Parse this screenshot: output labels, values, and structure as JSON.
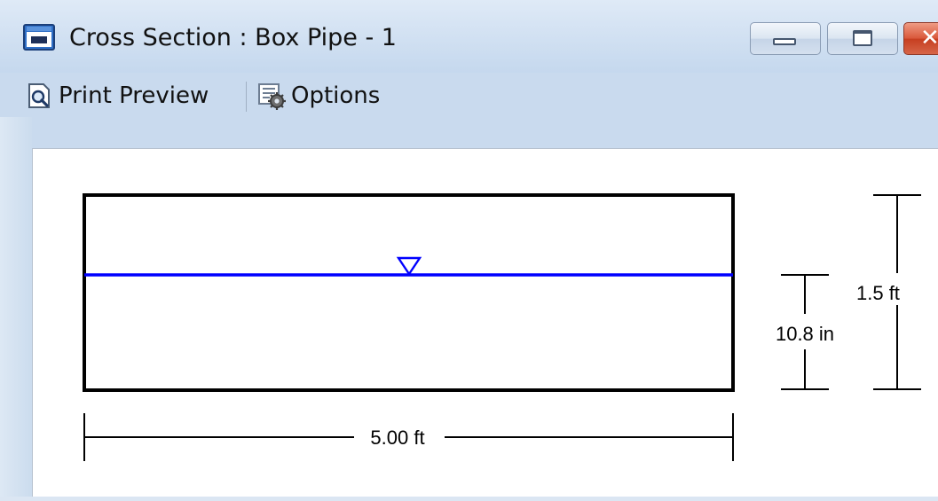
{
  "window": {
    "title": "Cross Section : Box Pipe - 1"
  },
  "toolbar": {
    "print_preview_label": "Print Preview",
    "options_label": "Options"
  },
  "icons": {
    "app": "cross-section-window-icon",
    "print_preview": "magnifier-page-icon",
    "options": "gear-grid-icon",
    "minimize": "minimize-icon",
    "maximize": "restore-icon",
    "close": "close-icon"
  },
  "section": {
    "shape": "box",
    "width_label": "5.00 ft",
    "rise_label": "1.5 ft",
    "depth_label": "10.8 in",
    "water_surface_color": "#0000ff",
    "outline_color": "#000000"
  }
}
